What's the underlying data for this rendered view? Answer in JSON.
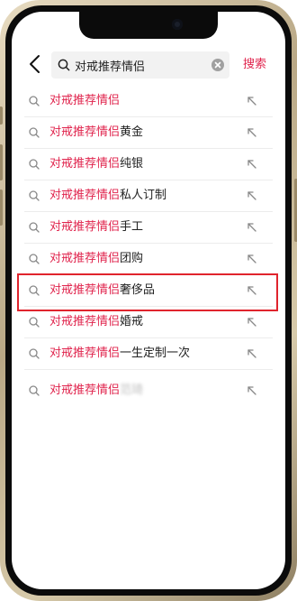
{
  "search": {
    "query": "对戒推荐情侣",
    "button_label": "搜索"
  },
  "colors": {
    "accent": "#e0244d",
    "annotation": "#e0242d"
  },
  "suggestions": [
    {
      "highlight": "对戒推荐情侣",
      "rest": ""
    },
    {
      "highlight": "对戒推荐情侣",
      "rest": "黄金"
    },
    {
      "highlight": "对戒推荐情侣",
      "rest": "纯银"
    },
    {
      "highlight": "对戒推荐情侣",
      "rest": "私人订制"
    },
    {
      "highlight": "对戒推荐情侣",
      "rest": "手工"
    },
    {
      "highlight": "对戒推荐情侣",
      "rest": "团购"
    },
    {
      "highlight": "对戒推荐情侣",
      "rest": "奢侈品"
    },
    {
      "highlight": "对戒推荐情侣",
      "rest": "婚戒"
    },
    {
      "highlight": "对戒推荐情侣",
      "rest": "一生定制一次"
    },
    {
      "highlight": "对戒推荐情侣",
      "rest": "范琦",
      "blurred": true
    }
  ],
  "icons": {
    "back": "chevron-left-icon",
    "search": "search-icon",
    "clear": "clear-icon",
    "fill_query": "arrow-up-left-icon"
  }
}
